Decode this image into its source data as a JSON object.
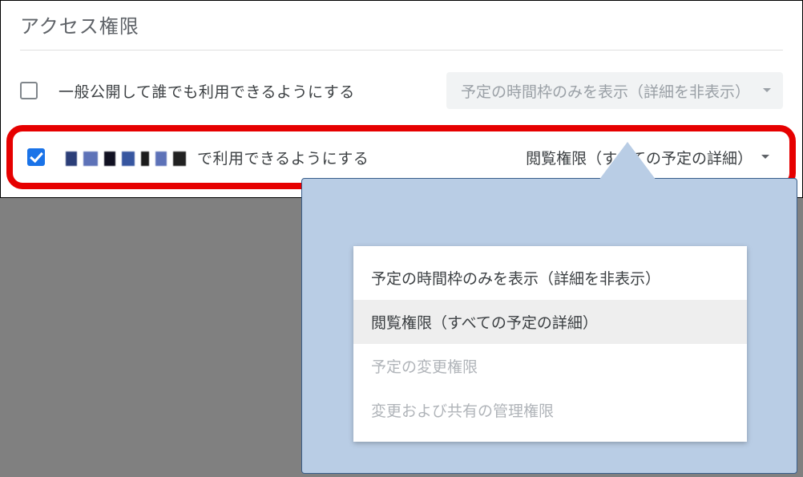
{
  "section_title": "アクセス権限",
  "rows": {
    "public": {
      "label": "一般公開して誰でも利用できるようにする",
      "select": "予定の時間枠のみを表示（詳細を非表示）"
    },
    "org": {
      "label_suffix": "で利用できるようにする",
      "select": "閲覧権限（すべての予定の詳細）"
    }
  },
  "dropdown": {
    "opt1": "予定の時間枠のみを表示（詳細を非表示）",
    "opt2": "閲覧権限（すべての予定の詳細）",
    "opt3": "予定の変更権限",
    "opt4": "変更および共有の管理権限"
  }
}
